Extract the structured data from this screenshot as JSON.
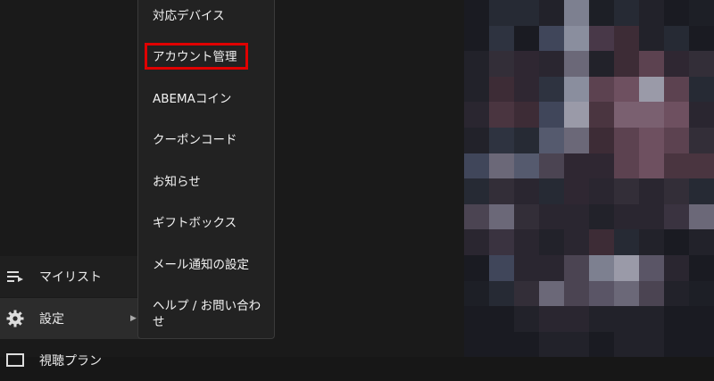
{
  "sidebar": {
    "items": [
      {
        "label": "マイリスト",
        "icon": "list-icon"
      },
      {
        "label": "設定",
        "icon": "gear-icon"
      },
      {
        "label": "視聴プラン",
        "icon": "plan-icon"
      }
    ]
  },
  "submenu": {
    "items": [
      {
        "label": "対応デバイス"
      },
      {
        "label": "アカウント管理"
      },
      {
        "label": "ABEMAコイン"
      },
      {
        "label": "クーポンコード"
      },
      {
        "label": "お知らせ"
      },
      {
        "label": "ギフトボックス"
      },
      {
        "label": "メール通知の設定"
      },
      {
        "label": "ヘルプ / お問い合わせ"
      }
    ],
    "highlighted": "アカウント管理",
    "highlight_color": "#e00000"
  }
}
